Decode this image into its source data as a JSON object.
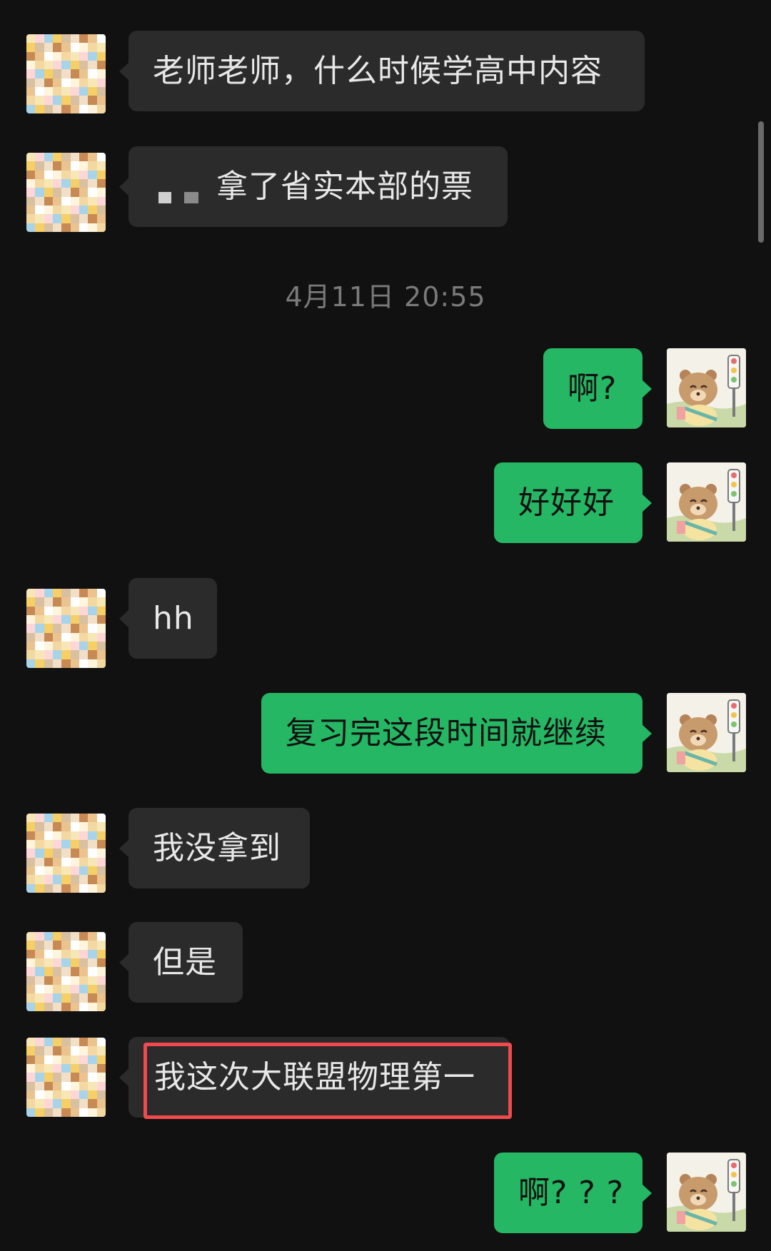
{
  "chat": {
    "timestamp": "4月11日 20:55",
    "messages": [
      {
        "id": "m1",
        "side": "left",
        "text": "老师老师，什么时候学高中内容"
      },
      {
        "id": "m2",
        "side": "left",
        "text": "拿了省实本部的票"
      },
      {
        "id": "m3",
        "side": "right",
        "text": "啊?"
      },
      {
        "id": "m4",
        "side": "right",
        "text": "好好好"
      },
      {
        "id": "m5",
        "side": "left",
        "text": "hh"
      },
      {
        "id": "m6",
        "side": "right",
        "text": "复习完这段时间就继续"
      },
      {
        "id": "m7",
        "side": "left",
        "text": "我没拿到"
      },
      {
        "id": "m8",
        "side": "left",
        "text": "但是"
      },
      {
        "id": "m9",
        "side": "left",
        "text": "我这次大联盟物理第一",
        "highlighted": true
      },
      {
        "id": "m10",
        "side": "right",
        "text": "啊? ? ?"
      }
    ]
  },
  "colors": {
    "background": "#111111",
    "left_bubble": "#2b2b2b",
    "right_bubble": "#25b763",
    "highlight_border": "#f04a4f",
    "timestamp": "#7a7a7a"
  },
  "icons": {
    "left_avatar": "pixelated-avatar-icon",
    "right_avatar": "bear-avatar-icon"
  }
}
